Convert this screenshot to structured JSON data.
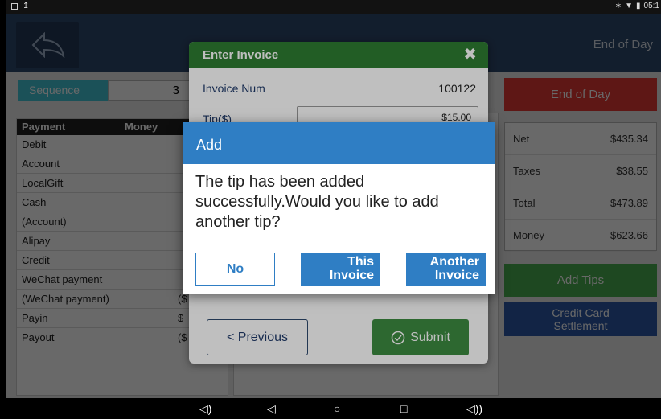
{
  "status_bar": {
    "time": "05:1",
    "left_icons": [
      "image-icon",
      "upload-icon"
    ],
    "right_icons": [
      "bluetooth-icon",
      "wifi-icon",
      "battery-icon"
    ]
  },
  "top_bar": {
    "title": "End of Day"
  },
  "sequence": {
    "label": "Sequence",
    "value": "3"
  },
  "payments": {
    "headers": [
      "Payment",
      "Money"
    ],
    "rows": [
      {
        "name": "Debit",
        "amount": ""
      },
      {
        "name": "Account",
        "amount": ""
      },
      {
        "name": "LocalGift",
        "amount": ""
      },
      {
        "name": "Cash",
        "amount": ""
      },
      {
        "name": "(Account)",
        "amount": ""
      },
      {
        "name": "Alipay",
        "amount": ""
      },
      {
        "name": "Credit",
        "amount": ""
      },
      {
        "name": "WeChat payment",
        "amount": ""
      },
      {
        "name": "(WeChat payment)",
        "amount": "($"
      },
      {
        "name": "Payin",
        "amount": "$"
      },
      {
        "name": "Payout",
        "amount": "($"
      }
    ]
  },
  "right_panel": {
    "end_of_day_label": "End of Day",
    "summary": [
      {
        "label": "Net",
        "value": "$435.34"
      },
      {
        "label": "Taxes",
        "value": "$38.55"
      },
      {
        "label": "Total",
        "value": "$473.89"
      },
      {
        "label": "Money",
        "value": "$623.66"
      }
    ],
    "add_tips_label": "Add Tips",
    "credit_card_line1": "Credit Card",
    "credit_card_line2": "Settlement"
  },
  "invoice_dialog": {
    "title": "Enter Invoice",
    "invoice_num_label": "Invoice Num",
    "invoice_num_value": "100122",
    "tip_label": "Tip($)",
    "tip_value": "$15.00",
    "previous_label": "Previous",
    "submit_label": "Submit"
  },
  "add_dialog": {
    "title": "Add",
    "message": "The tip has been added successfully.Would you like to add another tip?",
    "no_label": "No",
    "this_line1": "This",
    "this_line2": "Invoice",
    "another_line1": "Another",
    "another_line2": "Invoice"
  },
  "colors": {
    "top_bar": "#2e4a6e",
    "dialog_green": "#2e7d32",
    "alert_blue": "#2f7ec4",
    "end_of_day_red": "#e53935",
    "add_tips_green": "#4caf50",
    "credit_card_blue": "#2e5aa8"
  }
}
